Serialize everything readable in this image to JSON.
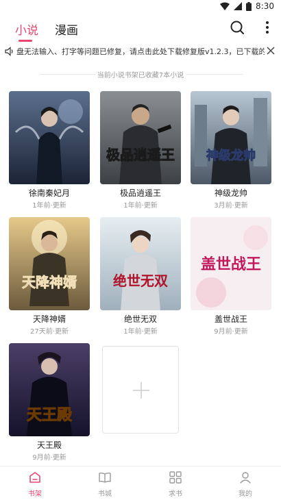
{
  "status_bar": {
    "time": "8:30"
  },
  "header": {
    "tabs": [
      {
        "label": "小说",
        "active": true
      },
      {
        "label": "漫画",
        "active": false
      }
    ],
    "accent_color": "#e8456f"
  },
  "notice": {
    "text": "盘无法输入、打字等问题已修复，请点击此处下载修复版v1.2.3，已下载的"
  },
  "shelf": {
    "info": "当前小说书架已收藏7本小说",
    "books": [
      {
        "title": "徐南秦妃月",
        "updated": "1年前·更新"
      },
      {
        "title": "极品逍遥王",
        "updated": "1年前·更新",
        "cover_text": "极品逍遥王"
      },
      {
        "title": "神级龙帅",
        "updated": "3月前·更新",
        "cover_text": "神级龙帅"
      },
      {
        "title": "天降神婿",
        "updated": "27天前·更新",
        "cover_text": "天降神婿"
      },
      {
        "title": "绝世无双",
        "updated": "1年前·更新",
        "cover_text": "绝世无双"
      },
      {
        "title": "盖世战王",
        "updated": "9月前·更新",
        "cover_text": "盖世战王"
      },
      {
        "title": "天王殿",
        "updated": "9月前·更新",
        "cover_text": "天王殿"
      }
    ]
  },
  "bottom_nav": [
    {
      "label": "书架",
      "icon": "bookshelf-icon",
      "active": true
    },
    {
      "label": "书城",
      "icon": "book-open-icon",
      "active": false
    },
    {
      "label": "求书",
      "icon": "grid-icon",
      "active": false
    },
    {
      "label": "我的",
      "icon": "person-icon",
      "active": false
    }
  ]
}
